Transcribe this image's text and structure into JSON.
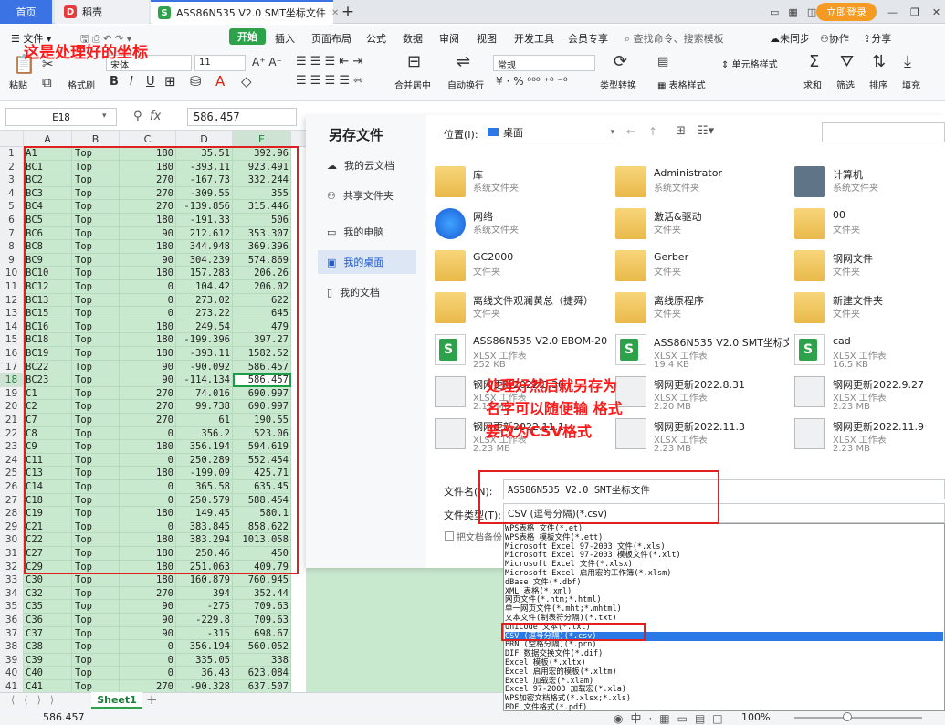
{
  "tabs": {
    "home": "首页",
    "daoke": "稻壳",
    "doc": "ASS86N535 V2.0 SMT坐标文件",
    "login": "立即登录"
  },
  "menu": {
    "file": "文件",
    "start": "开始",
    "items": [
      "插入",
      "页面布局",
      "公式",
      "数据",
      "审阅",
      "视图",
      "开发工具",
      "会员专享"
    ],
    "search": "查找命令、搜索模板",
    "sync": "未同步",
    "collab": "协作",
    "share": "分享"
  },
  "ribbon": {
    "paste": "粘贴",
    "format_painter": "格式刷",
    "font": "宋体",
    "font_size": "11",
    "merge": "合并居中",
    "wrap": "自动换行",
    "number_format": "常规",
    "type_convert": "类型转换",
    "cond_format": "条件格式",
    "table_style": "表格样式",
    "cell_style": "单元格样式",
    "sum": "求和",
    "filter": "筛选",
    "sort": "排序",
    "fill": "填充"
  },
  "formula_bar": {
    "cell_ref": "E18",
    "fx": "fx",
    "value": "586.457"
  },
  "annotations": {
    "top_note": "这是处理好的坐标",
    "mid_note_1": "处理好然后就另存为",
    "mid_note_2": "名字可以随便输  格式",
    "mid_note_3": "要改为CSV格式"
  },
  "columns": [
    "A",
    "B",
    "C",
    "D",
    "E"
  ],
  "rows": [
    [
      "A1",
      "Top",
      "180",
      "35.51",
      "392.96"
    ],
    [
      "BC1",
      "Top",
      "180",
      "-393.11",
      "923.491"
    ],
    [
      "BC2",
      "Top",
      "270",
      "-167.73",
      "332.244"
    ],
    [
      "BC3",
      "Top",
      "270",
      "-309.55",
      "355"
    ],
    [
      "BC4",
      "Top",
      "270",
      "-139.856",
      "315.446"
    ],
    [
      "BC5",
      "Top",
      "180",
      "-191.33",
      "506"
    ],
    [
      "BC6",
      "Top",
      "90",
      "212.612",
      "353.307"
    ],
    [
      "BC8",
      "Top",
      "180",
      "344.948",
      "369.396"
    ],
    [
      "BC9",
      "Top",
      "90",
      "304.239",
      "574.869"
    ],
    [
      "BC10",
      "Top",
      "180",
      "157.283",
      "206.26"
    ],
    [
      "BC12",
      "Top",
      "0",
      "104.42",
      "206.02"
    ],
    [
      "BC13",
      "Top",
      "0",
      "273.02",
      "622"
    ],
    [
      "BC15",
      "Top",
      "0",
      "273.22",
      "645"
    ],
    [
      "BC16",
      "Top",
      "180",
      "249.54",
      "479"
    ],
    [
      "BC18",
      "Top",
      "180",
      "-199.396",
      "397.27"
    ],
    [
      "BC19",
      "Top",
      "180",
      "-393.11",
      "1582.52"
    ],
    [
      "BC22",
      "Top",
      "90",
      "-90.092",
      "586.457"
    ],
    [
      "BC23",
      "Top",
      "90",
      "-114.134",
      "586.457"
    ],
    [
      "C1",
      "Top",
      "270",
      "74.016",
      "690.997"
    ],
    [
      "C2",
      "Top",
      "270",
      "99.738",
      "690.997"
    ],
    [
      "C7",
      "Top",
      "270",
      "61",
      "190.55"
    ],
    [
      "C8",
      "Top",
      "0",
      "356.2",
      "523.06"
    ],
    [
      "C9",
      "Top",
      "180",
      "356.194",
      "594.619"
    ],
    [
      "C11",
      "Top",
      "0",
      "250.289",
      "552.454"
    ],
    [
      "C13",
      "Top",
      "180",
      "-199.09",
      "425.71"
    ],
    [
      "C14",
      "Top",
      "0",
      "365.58",
      "635.45"
    ],
    [
      "C18",
      "Top",
      "0",
      "250.579",
      "588.454"
    ],
    [
      "C19",
      "Top",
      "180",
      "149.45",
      "580.1"
    ],
    [
      "C21",
      "Top",
      "0",
      "383.845",
      "858.622"
    ],
    [
      "C22",
      "Top",
      "180",
      "383.294",
      "1013.058"
    ],
    [
      "C27",
      "Top",
      "180",
      "250.46",
      "450"
    ],
    [
      "C29",
      "Top",
      "180",
      "251.063",
      "409.79"
    ],
    [
      "C30",
      "Top",
      "180",
      "160.879",
      "760.945"
    ],
    [
      "C32",
      "Top",
      "270",
      "394",
      "352.44"
    ],
    [
      "C35",
      "Top",
      "90",
      "-275",
      "709.63"
    ],
    [
      "C36",
      "Top",
      "90",
      "-229.8",
      "709.63"
    ],
    [
      "C37",
      "Top",
      "90",
      "-315",
      "698.67"
    ],
    [
      "C38",
      "Top",
      "0",
      "356.194",
      "560.052"
    ],
    [
      "C39",
      "Top",
      "0",
      "335.05",
      "338"
    ],
    [
      "C40",
      "Top",
      "0",
      "36.43",
      "623.084"
    ],
    [
      "C41",
      "Top",
      "270",
      "-90.328",
      "637.507"
    ]
  ],
  "sheet": {
    "name": "Sheet1",
    "status_value": "586.457",
    "zoom": "100%"
  },
  "dialog": {
    "title": "另存文件",
    "location_label": "位置(I):",
    "location_value": "桌面",
    "side": [
      "我的云文档",
      "共享文件夹",
      "我的电脑",
      "我的桌面",
      "我的文档"
    ],
    "files": [
      {
        "name": "库",
        "sub": "系统文件夹",
        "size": "",
        "kind": "folder"
      },
      {
        "name": "Administrator",
        "sub": "系统文件夹",
        "size": "",
        "kind": "user"
      },
      {
        "name": "计算机",
        "sub": "系统文件夹",
        "size": "",
        "kind": "pc"
      },
      {
        "name": "网络",
        "sub": "系统文件夹",
        "size": "",
        "kind": "net"
      },
      {
        "name": "激活&驱动",
        "sub": "文件夹",
        "size": "",
        "kind": "folder"
      },
      {
        "name": "00",
        "sub": "文件夹",
        "size": "",
        "kind": "folder"
      },
      {
        "name": "GC2000",
        "sub": "文件夹",
        "size": "",
        "kind": "folder"
      },
      {
        "name": "Gerber",
        "sub": "文件夹",
        "size": "",
        "kind": "folder"
      },
      {
        "name": "钢网文件",
        "sub": "文件夹",
        "size": "",
        "kind": "folder"
      },
      {
        "name": "离线文件观澜黄总（捷舜）",
        "sub": "文件夹",
        "size": "",
        "kind": "folder"
      },
      {
        "name": "离线原程序",
        "sub": "文件夹",
        "size": "",
        "kind": "folder"
      },
      {
        "name": "新建文件夹",
        "sub": "文件夹",
        "size": "",
        "kind": "folder"
      },
      {
        "name": "ASS86N535 V2.0 EBOM-202...",
        "sub": "XLSX 工作表",
        "size": "252 KB",
        "kind": "xlsx"
      },
      {
        "name": "ASS86N535 V2.0 SMT坐标文件",
        "sub": "XLSX 工作表",
        "size": "19.4 KB",
        "kind": "xlsx"
      },
      {
        "name": "cad",
        "sub": "XLSX 工作表",
        "size": "16.5 KB",
        "kind": "xlsx"
      },
      {
        "name": "钢网更新2022.8.30",
        "sub": "XLSX 工作表",
        "size": "2.17 MB",
        "kind": "xlsx2"
      },
      {
        "name": "钢网更新2022.8.31",
        "sub": "XLSX 工作表",
        "size": "2.20 MB",
        "kind": "xlsx2"
      },
      {
        "name": "钢网更新2022.9.27",
        "sub": "XLSX 工作表",
        "size": "2.23 MB",
        "kind": "xlsx2"
      },
      {
        "name": "钢网更新2022.11.1",
        "sub": "XLSX 工作表",
        "size": "2.23 MB",
        "kind": "xlsx2"
      },
      {
        "name": "钢网更新2022.11.3",
        "sub": "XLSX 工作表",
        "size": "2.23 MB",
        "kind": "xlsx2"
      },
      {
        "name": "钢网更新2022.11.9",
        "sub": "XLSX 工作表",
        "size": "2.23 MB",
        "kind": "xlsx2"
      }
    ],
    "filename_label": "文件名(N):",
    "filename_value": "ASS86N535  V2.0  SMT坐标文件",
    "filetype_label": "文件类型(T):",
    "filetype_value": "CSV (逗号分隔)(*.csv)",
    "backup_label": "把文档备份"
  },
  "filetype_options": [
    "WPS表格 文件(*.et)",
    "WPS表格 模板文件(*.ett)",
    "Microsoft Excel 97-2003 文件(*.xls)",
    "Microsoft Excel 97-2003 模板文件(*.xlt)",
    "Microsoft Excel 文件(*.xlsx)",
    "Microsoft Excel 启用宏的工作簿(*.xlsm)",
    "dBase 文件(*.dbf)",
    "XML 表格(*.xml)",
    "网页文件(*.htm;*.html)",
    "单一网页文件(*.mht;*.mhtml)",
    "文本文件(制表符分隔)(*.txt)",
    "Unicode 文本(*.txt)",
    "CSV (逗号分隔)(*.csv)",
    "PRN (空格分隔)(*.prn)",
    "DIF 数据交换文件(*.dif)",
    "Excel 模板(*.xltx)",
    "Excel 启用宏的模板(*.xltm)",
    "Excel 加载宏(*.xlam)",
    "Excel 97-2003 加载宏(*.xla)",
    "WPS加密文档格式(*.xlsx;*.xls)",
    "PDF 文件格式(*.pdf)"
  ]
}
